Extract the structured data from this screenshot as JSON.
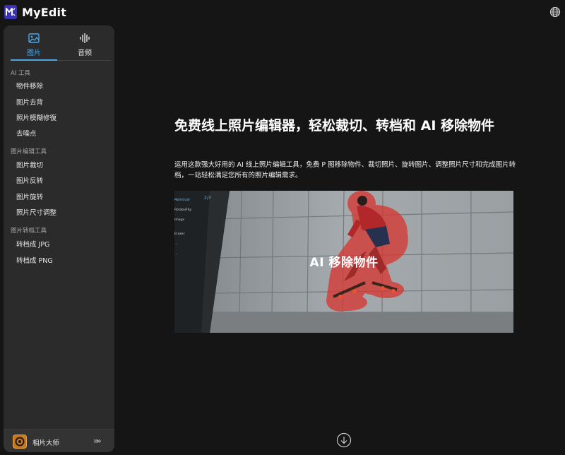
{
  "app": {
    "name": "MyEdit"
  },
  "sidebar": {
    "tabs": [
      {
        "label": "图片",
        "icon": "image-icon",
        "active": true
      },
      {
        "label": "音频",
        "icon": "audio-wave-icon",
        "active": false
      }
    ],
    "sections": [
      {
        "title": "AI 工具",
        "items": [
          "物件移除",
          "图片去背",
          "照片模糊修復",
          "去噪点"
        ]
      },
      {
        "title": "图片编辑工具",
        "items": [
          "图片裁切",
          "图片反转",
          "图片旋转",
          "照片尺寸调整"
        ]
      },
      {
        "title": "图片转档工具",
        "items": [
          "转档成 JPG",
          "转档成 PNG"
        ]
      }
    ],
    "promo": {
      "label": "相片大师",
      "icon": "photodirector-icon",
      "arrow": "»»"
    }
  },
  "main": {
    "title": "免费线上照片编辑器，轻松裁切、转档和 AI 移除物件",
    "description": "运用这款强大好用的 AI 线上照片编辑工具，免费 P 图移除物件、裁切照片、旋转图片、调整照片尺寸和完成图片转档，一站轻松满足您所有的照片编辑需求。",
    "hero": {
      "caption": "AI 移除物件",
      "panel_items": [
        "Removal",
        "Rotate/Flip",
        "Image",
        "Eraser",
        "...",
        "..."
      ],
      "panel_badge": "2/3"
    }
  },
  "colors": {
    "accent": "#4aa6e8",
    "logo": "#3b32b3",
    "highlight": "#e0312f"
  }
}
